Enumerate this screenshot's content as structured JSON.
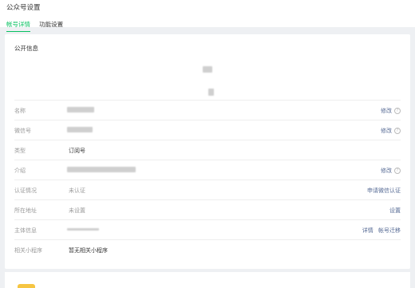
{
  "page": {
    "title": "公众号设置"
  },
  "tabs": [
    {
      "label": "帐号详情",
      "active": true
    },
    {
      "label": "功能设置",
      "active": false
    }
  ],
  "public_info": {
    "section_title": "公开信息",
    "rows": [
      {
        "label": "名称",
        "value": "",
        "action": "修改"
      },
      {
        "label": "微信号",
        "value": "",
        "action": "修改"
      },
      {
        "label": "类型",
        "value": "订阅号",
        "action": ""
      },
      {
        "label": "介绍",
        "value": "",
        "action": "修改"
      },
      {
        "label": "认证情况",
        "value": "未认证",
        "action": "申请微信认证"
      },
      {
        "label": "所在地址",
        "value": "未设置",
        "action": "设置"
      },
      {
        "label": "主体信息",
        "value": "",
        "action": "详情",
        "action2": "帐号迁移"
      },
      {
        "label": "相关小程序",
        "value": "暂无相关小程序",
        "action": ""
      }
    ]
  },
  "colors": {
    "accent": "#07c160",
    "link": "#576b95",
    "muted": "#9a9a9a",
    "badge": "#f6c542"
  }
}
